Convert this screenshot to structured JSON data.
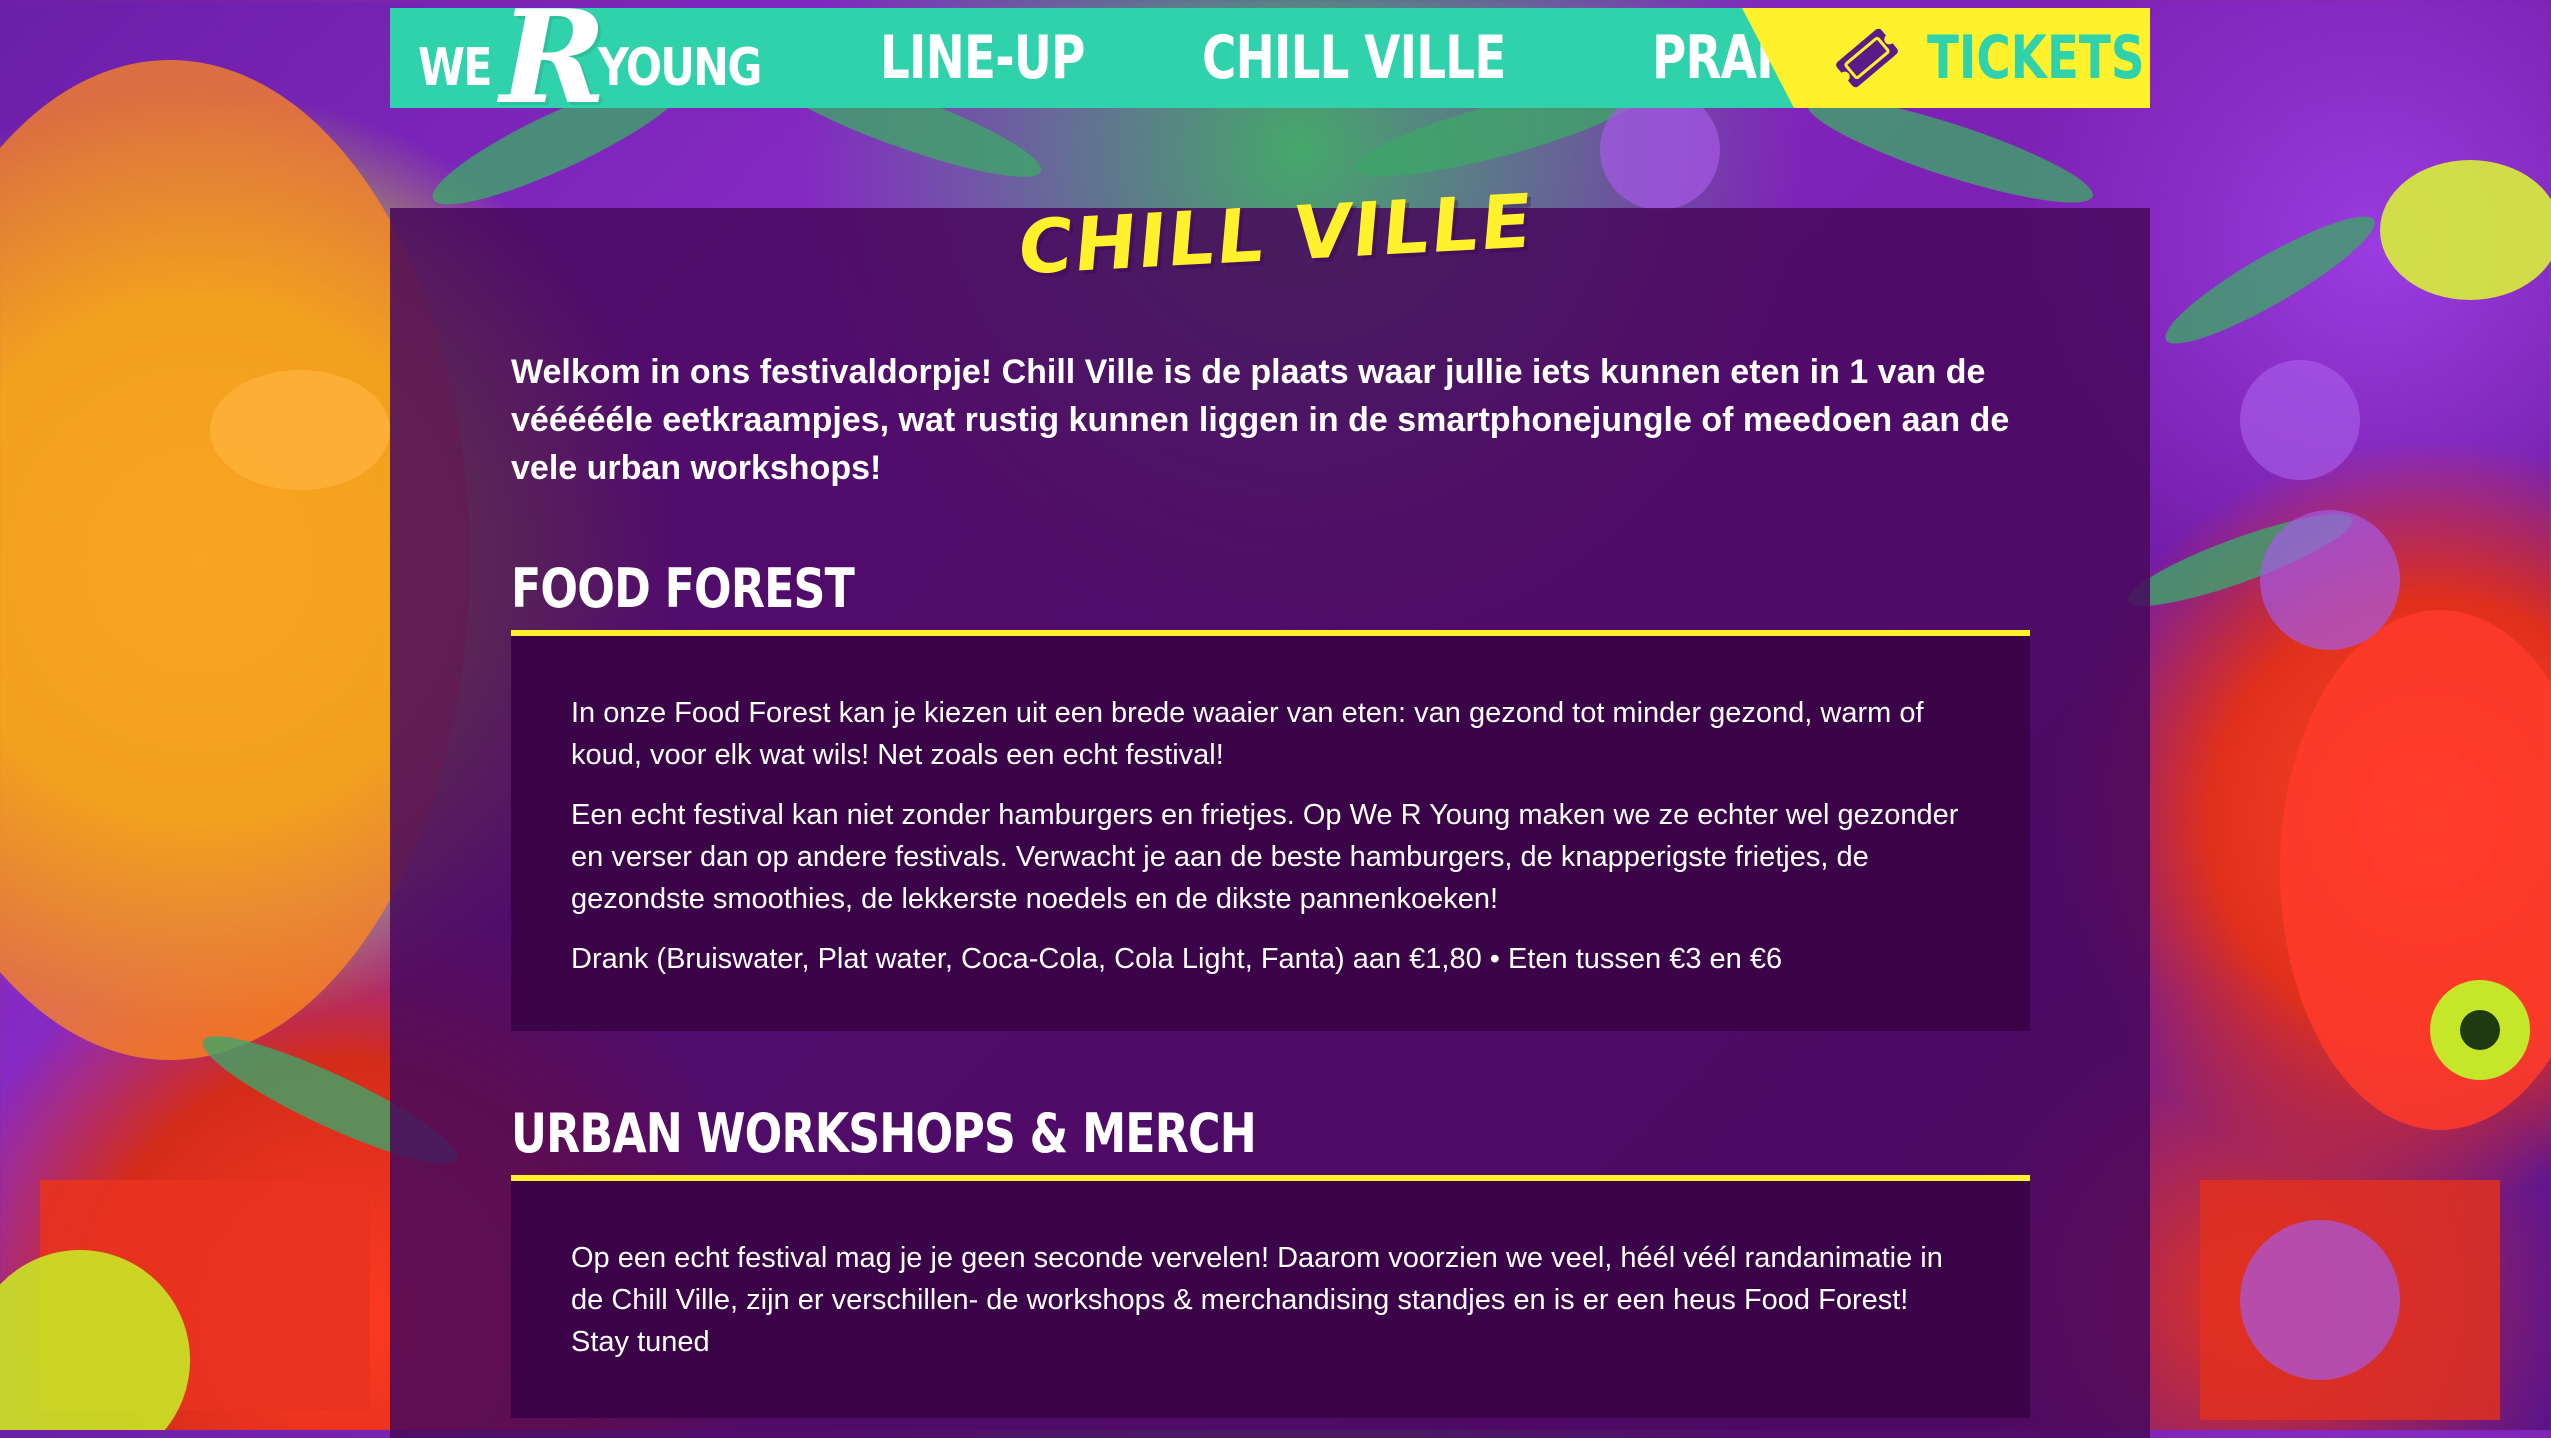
{
  "brand": {
    "we": "WE",
    "r": "R",
    "young": "YOUNG"
  },
  "nav": {
    "links": [
      "LINE-UP",
      "CHILL VILLE",
      "PRAKTISCH"
    ],
    "tickets_label": "TICKETS"
  },
  "page": {
    "title": "CHILL VILLE"
  },
  "intro": "Welkom in ons festivaldorpje! Chill Ville is de plaats waar jullie iets kunnen eten in 1 van de véééééle eetkraampjes, wat rustig kunnen liggen in de smartphonejungle of meedoen aan de vele urban workshops!",
  "sections": [
    {
      "heading": "FOOD FOREST",
      "paragraphs": [
        "In onze Food Forest kan je kiezen uit een brede waaier van eten: van gezond tot minder gezond, warm of koud, voor elk wat wils! Net zoals een echt festival!",
        "Een echt festival kan niet zonder hamburgers en frietjes. Op We R Young maken we ze echter wel gezonder en verser dan op andere festivals. Verwacht je aan de beste hamburgers, de knapperigste frietjes, de gezondste smoothies, de lekkerste noedels en de dikste pannenkoeken!",
        "Drank (Bruiswater, Plat water, Coca-Cola, Cola Light, Fanta) aan €1,80 • Eten tussen €3 en €6"
      ]
    },
    {
      "heading": "URBAN WORKSHOPS & MERCH",
      "paragraphs": [
        "Op een echt festival mag je je geen seconde vervelen! Daarom voorzien we veel, héél véél randanimatie in de Chill Ville, zijn er verschillen- de workshops & merchandising standjes en is er een heus Food Forest! Stay tuned"
      ]
    }
  ],
  "colors": {
    "nav_teal": "#2fd2aa",
    "accent_yellow": "#fff22c",
    "panel_purple": "#48085c",
    "box_purple": "#3c0448"
  },
  "icons": {
    "tickets": "ticket-icon"
  }
}
